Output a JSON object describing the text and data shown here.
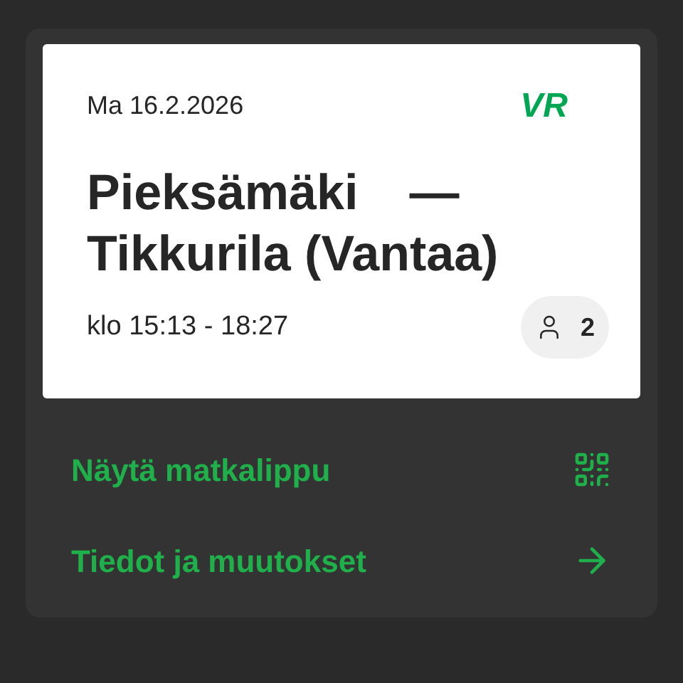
{
  "ticket": {
    "date": "Ma 16.2.2026",
    "logo": "VR",
    "from": "Pieksämäki",
    "separator": "—",
    "to": "Tikkurila (Vantaa)",
    "time": "klo 15:13 - 18:27",
    "passengers": "2"
  },
  "actions": [
    {
      "label": "Näytä matkalippu",
      "kind": "qr"
    },
    {
      "label": "Tiedot ja muutokset",
      "kind": "arrow"
    }
  ]
}
